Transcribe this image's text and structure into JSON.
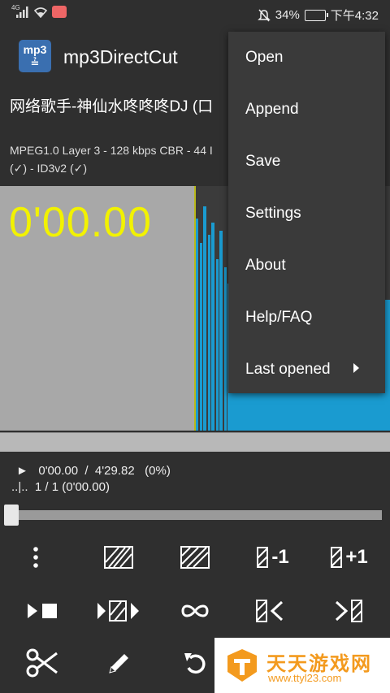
{
  "statusbar": {
    "network": "4G",
    "battery": "34%",
    "time": "下午4:32"
  },
  "appbar": {
    "logo_text": "mp3",
    "title": "mp3DirectCut"
  },
  "file": {
    "title": "网络歌手-神仙水咚咚咚DJ (口",
    "info_line1": "MPEG1.0 Layer 3 - 128 kbps CBR - 44 I",
    "info_line2": "(✓) - ID3v2 (✓)"
  },
  "waveform": {
    "time": "0'00.00",
    "colors": {
      "left_bg": "#a8a8a8",
      "wave": "#1a9bd0",
      "time": "#f2f200"
    }
  },
  "position": {
    "line1": "►   0'00.00  /  4'29.82   (0%)",
    "line2": "..|..  1 / 1 (0'00.00)"
  },
  "slider": {
    "value": 0
  },
  "buttons": {
    "row1": [
      "more-vert-icon",
      "select-region-icon",
      "select-all-icon",
      "prev-minus-icon",
      "next-plus-icon"
    ],
    "minus_label": "-1",
    "plus_label": "+1"
  },
  "menu": {
    "items": [
      "Open",
      "Append",
      "Save",
      "Settings",
      "About",
      "Help/FAQ",
      "Last opened"
    ]
  },
  "watermark": {
    "text1": "天天游戏网",
    "text2": "www.ttyl23.com"
  }
}
